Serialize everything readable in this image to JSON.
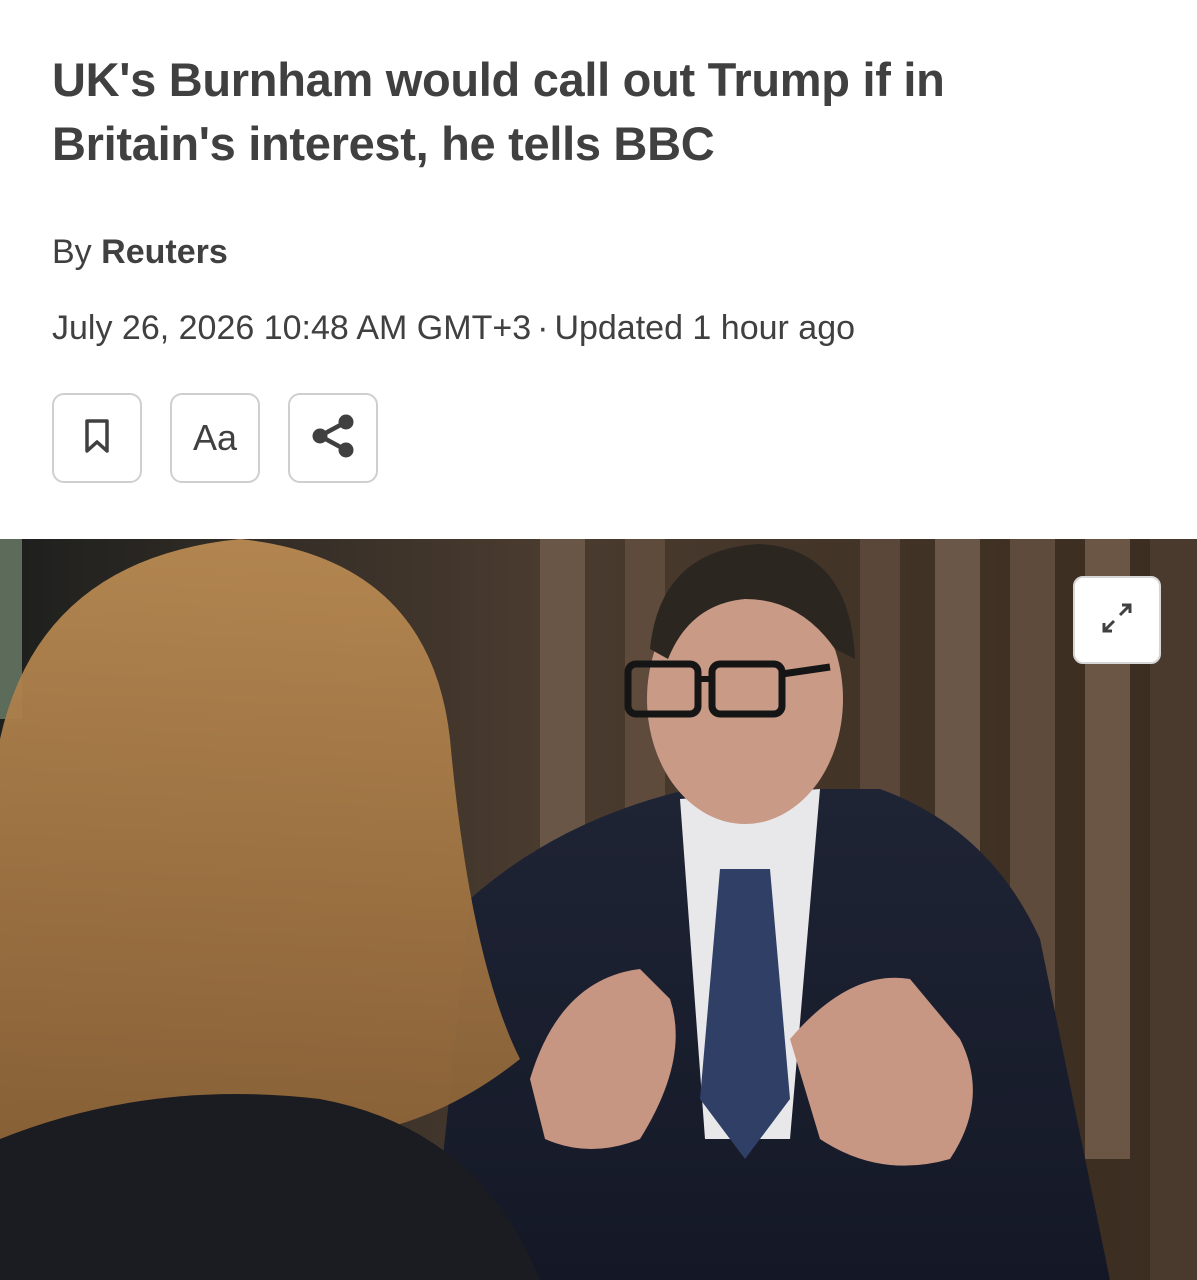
{
  "article": {
    "headline": "UK's Burnham would call out Trump if in Britain's interest, he tells BBC",
    "byline_prefix": "By",
    "byline_author": "Reuters",
    "date": "July 26, 2026 10:48 AM GMT+3",
    "separator": "·",
    "updated": "Updated 1 hour ago"
  },
  "toolbar": {
    "bookmark_icon": "bookmark-icon",
    "text_size_label": "Aa",
    "share_icon": "share-icon"
  },
  "hero": {
    "expand_icon": "expand-icon",
    "description_hidden": ""
  },
  "colors": {
    "text": "#404040",
    "button_border": "#cfcfcf"
  }
}
